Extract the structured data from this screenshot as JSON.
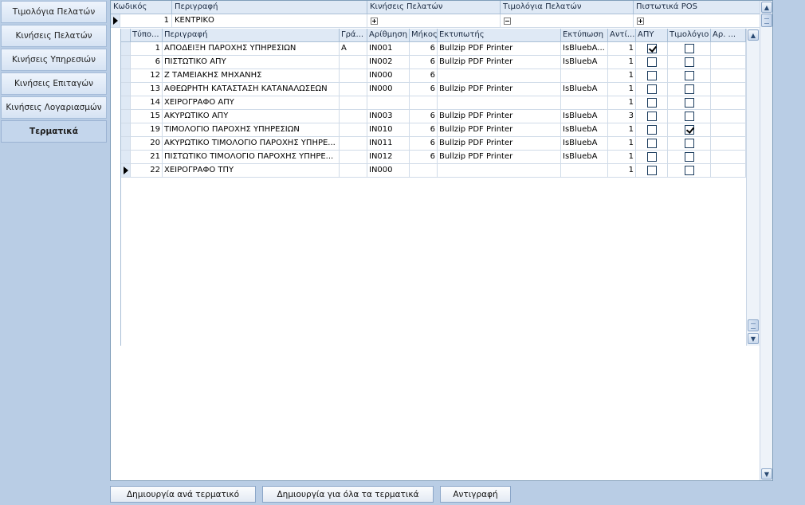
{
  "sidebar": {
    "items": [
      {
        "label": "Τιμολόγια Πελατών"
      },
      {
        "label": "Κινήσεις Πελατών"
      },
      {
        "label": "Κινήσεις Υπηρεσιών"
      },
      {
        "label": "Κινήσεις Επιταγών"
      },
      {
        "label": "Κινήσεις Λογαριασμών"
      },
      {
        "label": "Τερματικά",
        "active": true
      }
    ]
  },
  "master": {
    "columns": [
      "Κωδικός",
      "Περιγραφή",
      "Κινήσεις Πελατών",
      "Τιμολόγια Πελατών",
      "Πιστωτικά POS"
    ],
    "row": {
      "code": "1",
      "description": "ΚΕΝΤΡΙΚΟ"
    }
  },
  "detail": {
    "columns": [
      "Τύπο...",
      "Περιγραφή",
      "Γρά...",
      "Αρίθμηση",
      "Μήκος",
      "Εκτυπωτής",
      "Εκτύπωση",
      "Αντί...",
      "ΑΠΥ",
      "Τιμολόγιο",
      "Αρ. ..."
    ],
    "rows": [
      {
        "type": "1",
        "description": "ΑΠΟΔΕΙΞΗ ΠΑΡΟΧΗΣ ΥΠΗΡΕΣΙΩΝ",
        "letter": "A",
        "numbering": "IN001",
        "length": "6",
        "printer": "Bullzip PDF Printer",
        "print": "IsBluebA...",
        "copies": "1",
        "apy": true,
        "invoice": false
      },
      {
        "type": "6",
        "description": "ΠΙΣΤΩΤΙΚΟ ΑΠΥ",
        "letter": "",
        "numbering": "IN002",
        "length": "6",
        "printer": "Bullzip PDF Printer",
        "print": "IsBluebA",
        "copies": "1",
        "apy": false,
        "invoice": false
      },
      {
        "type": "12",
        "description": "Ζ ΤΑΜΕΙΑΚΗΣ ΜΗΧΑΝΗΣ",
        "letter": "",
        "numbering": "IN000",
        "length": "6",
        "printer": "",
        "print": "",
        "copies": "1",
        "apy": false,
        "invoice": false
      },
      {
        "type": "13",
        "description": "ΑΘΕΩΡΗΤΗ ΚΑΤΑΣΤΑΣΗ ΚΑΤΑΝΑΛΩΣΕΩΝ",
        "letter": "",
        "numbering": "IN000",
        "length": "6",
        "printer": "Bullzip PDF Printer",
        "print": "IsBluebA",
        "copies": "1",
        "apy": false,
        "invoice": false
      },
      {
        "type": "14",
        "description": "ΧΕΙΡΟΓΡΑΦΟ ΑΠΥ",
        "letter": "",
        "numbering": "",
        "length": "",
        "printer": "",
        "print": "",
        "copies": "1",
        "apy": false,
        "invoice": false
      },
      {
        "type": "15",
        "description": "ΑΚΥΡΩΤΙΚΟ ΑΠΥ",
        "letter": "",
        "numbering": "IN003",
        "length": "6",
        "printer": "Bullzip PDF Printer",
        "print": "IsBluebA",
        "copies": "3",
        "apy": false,
        "invoice": false
      },
      {
        "type": "19",
        "description": "ΤΙΜΟΛΟΓΙΟ ΠΑΡΟΧΗΣ ΥΠΗΡΕΣΙΩΝ",
        "letter": "",
        "numbering": "IN010",
        "length": "6",
        "printer": "Bullzip PDF Printer",
        "print": "IsBluebA",
        "copies": "1",
        "apy": false,
        "invoice": true
      },
      {
        "type": "20",
        "description": "ΑΚΥΡΩΤΙΚΟ ΤΙΜΟΛΟΓΙΟ ΠΑΡΟΧΗΣ ΥΠΗΡΕ...",
        "letter": "",
        "numbering": "IN011",
        "length": "6",
        "printer": "Bullzip PDF Printer",
        "print": "IsBluebA",
        "copies": "1",
        "apy": false,
        "invoice": false
      },
      {
        "type": "21",
        "description": "ΠΙΣΤΩΤΙΚΟ ΤΙΜΟΛΟΓΙΟ ΠΑΡΟΧΗΣ ΥΠΗΡΕ...",
        "letter": "",
        "numbering": "IN012",
        "length": "6",
        "printer": "Bullzip PDF Printer",
        "print": "IsBluebA",
        "copies": "1",
        "apy": false,
        "invoice": false
      },
      {
        "type": "22",
        "description": "ΧΕΙΡΟΓΡΑΦΟ ΤΠΥ",
        "letter": "",
        "numbering": "IN000",
        "length": "",
        "printer": "",
        "print": "",
        "copies": "1",
        "apy": false,
        "invoice": false,
        "current": true
      }
    ]
  },
  "buttons": {
    "create_per_terminal": "Δημιουργία ανά τερματικό",
    "create_all_terminals": "Δημιουργία για όλα τα τερματικά",
    "copy": "Αντιγραφή"
  },
  "colors": {
    "background": "#b9cde5",
    "header": "#dfe9f5",
    "grid_line": "#d0dbe8"
  }
}
